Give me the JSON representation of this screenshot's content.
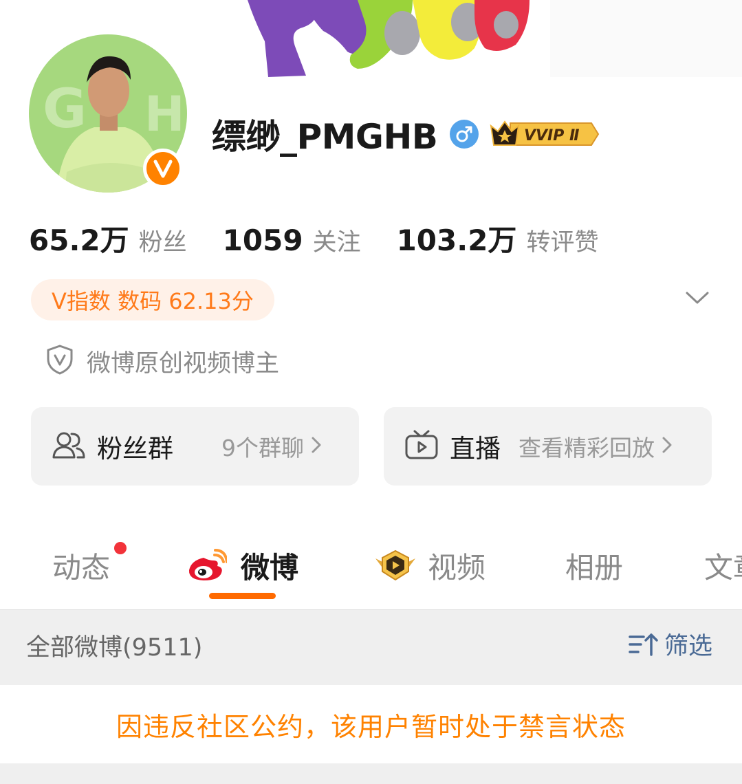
{
  "profile": {
    "username": "缥缈_PMGHB",
    "gender_icon": "male-symbol-icon",
    "vip_badge": "VVIP Ⅱ",
    "verified_icon": "orange-v-verified-icon"
  },
  "stats": [
    {
      "value": "65.2万",
      "label": "粉丝"
    },
    {
      "value": "1059",
      "label": "关注"
    },
    {
      "value": "103.2万",
      "label": "转评赞"
    }
  ],
  "v_index": "V指数 数码 62.13分",
  "certification": "微博原创视频博主",
  "cards": {
    "fans_group": {
      "title": "粉丝群",
      "subtitle": "9个群聊"
    },
    "live": {
      "title": "直播",
      "subtitle": "查看精彩回放"
    }
  },
  "tabs": [
    {
      "label": "动态",
      "has_dot": true
    },
    {
      "label": "微博",
      "active": true
    },
    {
      "label": "视频"
    },
    {
      "label": "相册"
    },
    {
      "label": "文章"
    }
  ],
  "feed": {
    "all_posts_label": "全部微博(9511)",
    "filter_label": "筛选"
  },
  "notice": "因违反社区公约，该用户暂时处于禁言状态",
  "colors": {
    "accent_orange": "#ff8200",
    "tab_underline": "#ff6a00",
    "filter_blue": "#4a6a95",
    "v_index_bg": "#fff1e8"
  }
}
